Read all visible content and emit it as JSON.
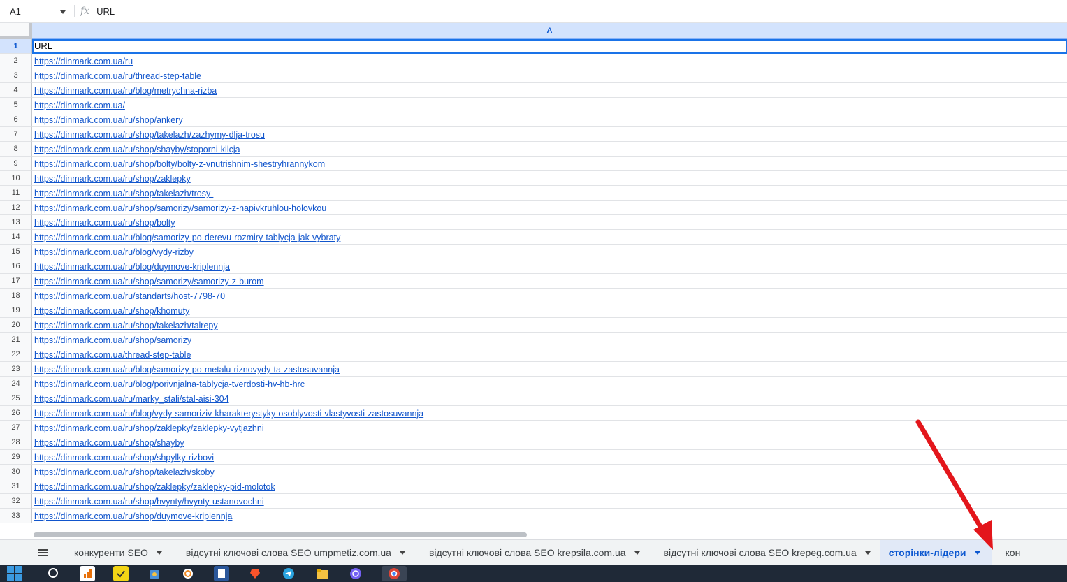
{
  "formula_bar": {
    "cell_ref": "A1",
    "fx_symbol": "fx",
    "value": "URL"
  },
  "column_headers": [
    "A"
  ],
  "rows": [
    {
      "num": "1",
      "value": "URL"
    },
    {
      "num": "2",
      "value": "https://dinmark.com.ua/ru"
    },
    {
      "num": "3",
      "value": "https://dinmark.com.ua/ru/thread-step-table"
    },
    {
      "num": "4",
      "value": "https://dinmark.com.ua/ru/blog/metrychna-rizba"
    },
    {
      "num": "5",
      "value": "https://dinmark.com.ua/"
    },
    {
      "num": "6",
      "value": "https://dinmark.com.ua/ru/shop/ankery"
    },
    {
      "num": "7",
      "value": "https://dinmark.com.ua/ru/shop/takelazh/zazhymy-dlja-trosu"
    },
    {
      "num": "8",
      "value": "https://dinmark.com.ua/ru/shop/shayby/stoporni-kilcja"
    },
    {
      "num": "9",
      "value": "https://dinmark.com.ua/ru/shop/bolty/bolty-z-vnutrishnim-shestryhrannykom"
    },
    {
      "num": "10",
      "value": "https://dinmark.com.ua/ru/shop/zaklepky"
    },
    {
      "num": "11",
      "value": "https://dinmark.com.ua/ru/shop/takelazh/trosy-"
    },
    {
      "num": "12",
      "value": "https://dinmark.com.ua/ru/shop/samorizy/samorizy-z-napivkruhlou-holovkou"
    },
    {
      "num": "13",
      "value": "https://dinmark.com.ua/ru/shop/bolty"
    },
    {
      "num": "14",
      "value": "https://dinmark.com.ua/ru/blog/samorizy-po-derevu-rozmiry-tablycja-jak-vybraty"
    },
    {
      "num": "15",
      "value": "https://dinmark.com.ua/ru/blog/vydy-rizby"
    },
    {
      "num": "16",
      "value": "https://dinmark.com.ua/ru/blog/duymove-kriplennja"
    },
    {
      "num": "17",
      "value": "https://dinmark.com.ua/ru/shop/samorizy/samorizy-z-burom"
    },
    {
      "num": "18",
      "value": "https://dinmark.com.ua/ru/standarts/host-7798-70"
    },
    {
      "num": "19",
      "value": "https://dinmark.com.ua/ru/shop/khomuty"
    },
    {
      "num": "20",
      "value": "https://dinmark.com.ua/ru/shop/takelazh/talrepy"
    },
    {
      "num": "21",
      "value": "https://dinmark.com.ua/ru/shop/samorizy"
    },
    {
      "num": "22",
      "value": "https://dinmark.com.ua/thread-step-table"
    },
    {
      "num": "23",
      "value": "https://dinmark.com.ua/ru/blog/samorizy-po-metalu-riznovydy-ta-zastosuvannja"
    },
    {
      "num": "24",
      "value": "https://dinmark.com.ua/ru/blog/porivnjalna-tablycja-tverdosti-hv-hb-hrc"
    },
    {
      "num": "25",
      "value": "https://dinmark.com.ua/ru/marky_stali/stal-aisi-304"
    },
    {
      "num": "26",
      "value": "https://dinmark.com.ua/ru/blog/vydy-samoriziv-kharakterystyky-osoblyvosti-vlastyvosti-zastosuvannja"
    },
    {
      "num": "27",
      "value": "https://dinmark.com.ua/ru/shop/zaklepky/zaklepky-vytjazhni"
    },
    {
      "num": "28",
      "value": "https://dinmark.com.ua/ru/shop/shayby"
    },
    {
      "num": "29",
      "value": "https://dinmark.com.ua/ru/shop/shpylky-rizbovi"
    },
    {
      "num": "30",
      "value": "https://dinmark.com.ua/ru/shop/takelazh/skoby"
    },
    {
      "num": "31",
      "value": "https://dinmark.com.ua/ru/shop/zaklepky/zaklepky-pid-molotok"
    },
    {
      "num": "32",
      "value": "https://dinmark.com.ua/ru/shop/hvynty/hvynty-ustanovochni"
    },
    {
      "num": "33",
      "value": "https://dinmark.com.ua/ru/shop/duymove-kriplennja"
    }
  ],
  "sheet_tabs": [
    {
      "label": "конкуренти SEO",
      "active": false
    },
    {
      "label": "відсутні ключові слова SEO umpmetiz.com.ua",
      "active": false
    },
    {
      "label": "відсутні ключові слова SEO krepsila.com.ua",
      "active": false
    },
    {
      "label": "відсутні ключові слова SEO krepeg.com.ua",
      "active": false
    },
    {
      "label": "сторінки-лідери",
      "active": true
    },
    {
      "label": "кон",
      "active": false
    }
  ],
  "colors": {
    "link": "#1155cc",
    "selection": "#1a73e8",
    "annotation_arrow": "#e3161b",
    "active_tab_text": "#0b57d0"
  },
  "taskbar_icons": [
    "windows-start-icon",
    "search-icon",
    "chart-app-icon",
    "sticky-notes-icon",
    "paint-app-icon",
    "vpn-app-icon",
    "office-app-icon",
    "brave-browser-icon",
    "telegram-icon",
    "file-explorer-icon",
    "viber-icon",
    "chrome-icon"
  ]
}
